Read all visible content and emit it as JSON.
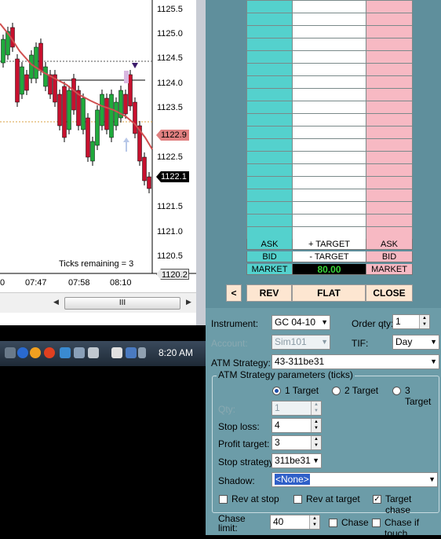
{
  "chart": {
    "y_axis_labels": [
      "1125.5",
      "1125.0",
      "1124.5",
      "1124.0",
      "1123.5",
      "1123.0",
      "1122.5",
      "1122.0",
      "1121.5",
      "1121.0",
      "1120.5"
    ],
    "x_axis_labels": [
      "0",
      "07:47",
      "07:58",
      "08:10"
    ],
    "price_tag_red": "1122.9",
    "price_tag_black": "1122.1",
    "price_tag_gray": "1120.2",
    "ticks_remaining": "Ticks remaining = 3",
    "scroll_thumb_glyph": "III",
    "colors": {
      "up_candle": "#1faa3c",
      "down_candle": "#c8102e",
      "ma_line": "#d05050",
      "target_tag": "#e08080"
    }
  },
  "taskbar": {
    "clock": "8:20 AM"
  },
  "ladder": {
    "ask_label": "ASK",
    "bid_label": "BID",
    "market_label": "MARKET",
    "plus_target": "+ TARGET",
    "minus_target": "- TARGET",
    "pnl_value": "80.00",
    "ask_label_right": "ASK",
    "bid_label_right": "BID",
    "market_label_right": "MARKET"
  },
  "buttons": {
    "back": "<",
    "rev": "REV",
    "flat": "FLAT",
    "close": "CLOSE"
  },
  "order_panel": {
    "instrument_label": "Instrument:",
    "instrument_value": "GC 04-10",
    "order_qty_label": "Order qty:",
    "order_qty_value": "1",
    "account_label": "Account:",
    "account_value": "Sim101",
    "tif_label": "TIF:",
    "tif_value": "Day",
    "atm_strategy_label": "ATM Strategy:",
    "atm_strategy_value": "43-311be31",
    "atm_params_title": "ATM Strategy parameters (ticks)",
    "target_options": [
      "1 Target",
      "2 Target",
      "3 Target"
    ],
    "selected_target": "1 Target",
    "qty_label": "Qty:",
    "qty_value": "1",
    "stop_loss_label": "Stop loss:",
    "stop_loss_value": "4",
    "profit_target_label": "Profit target:",
    "profit_target_value": "3",
    "stop_strategy_label": "Stop strategy:",
    "stop_strategy_value": "311be31",
    "shadow_label": "Shadow:",
    "shadow_value": "<None>",
    "rev_at_stop_label": "Rev at stop",
    "rev_at_target_label": "Rev at target",
    "target_chase_label": "Target chase",
    "target_chase_checked": true,
    "chase_limit_label_1": "Chase",
    "chase_limit_label_2": "limit:",
    "chase_limit_value": "40",
    "chase_label": "Chase",
    "chase_if_touch_label": "Chase if touch"
  }
}
